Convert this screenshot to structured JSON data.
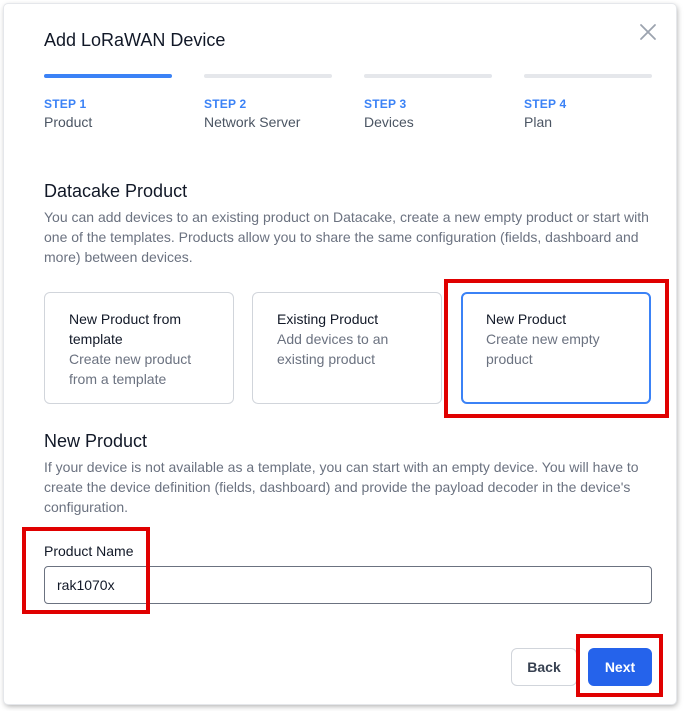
{
  "dialog": {
    "title": "Add LoRaWAN Device",
    "close_icon": "close-icon"
  },
  "steps": [
    {
      "number": "STEP 1",
      "label": "Product",
      "active": true
    },
    {
      "number": "STEP 2",
      "label": "Network Server",
      "active": false
    },
    {
      "number": "STEP 3",
      "label": "Devices",
      "active": false
    },
    {
      "number": "STEP 4",
      "label": "Plan",
      "active": false
    }
  ],
  "product_section": {
    "title": "Datacake Product",
    "description": "You can add devices to an existing product on Datacake, create a new empty product or start with one of the templates. Products allow you to share the same configuration (fields, dashboard and more) between devices."
  },
  "options": [
    {
      "title": "New Product from template",
      "description": "Create new product from a template",
      "selected": false
    },
    {
      "title": "Existing Product",
      "description": "Add devices to an existing product",
      "selected": false
    },
    {
      "title": "New Product",
      "description": "Create new empty product",
      "selected": true
    }
  ],
  "new_product": {
    "title": "New Product",
    "description": "If your device is not available as a template, you can start with an empty device. You will have to create the device definition (fields, dashboard) and provide the payload decoder in the device's configuration.",
    "field_label": "Product Name",
    "field_value": "rak1070x"
  },
  "footer": {
    "back_label": "Back",
    "next_label": "Next"
  },
  "colors": {
    "accent": "#3b82f6",
    "primary_button": "#2563eb",
    "highlight": "#e00000"
  }
}
